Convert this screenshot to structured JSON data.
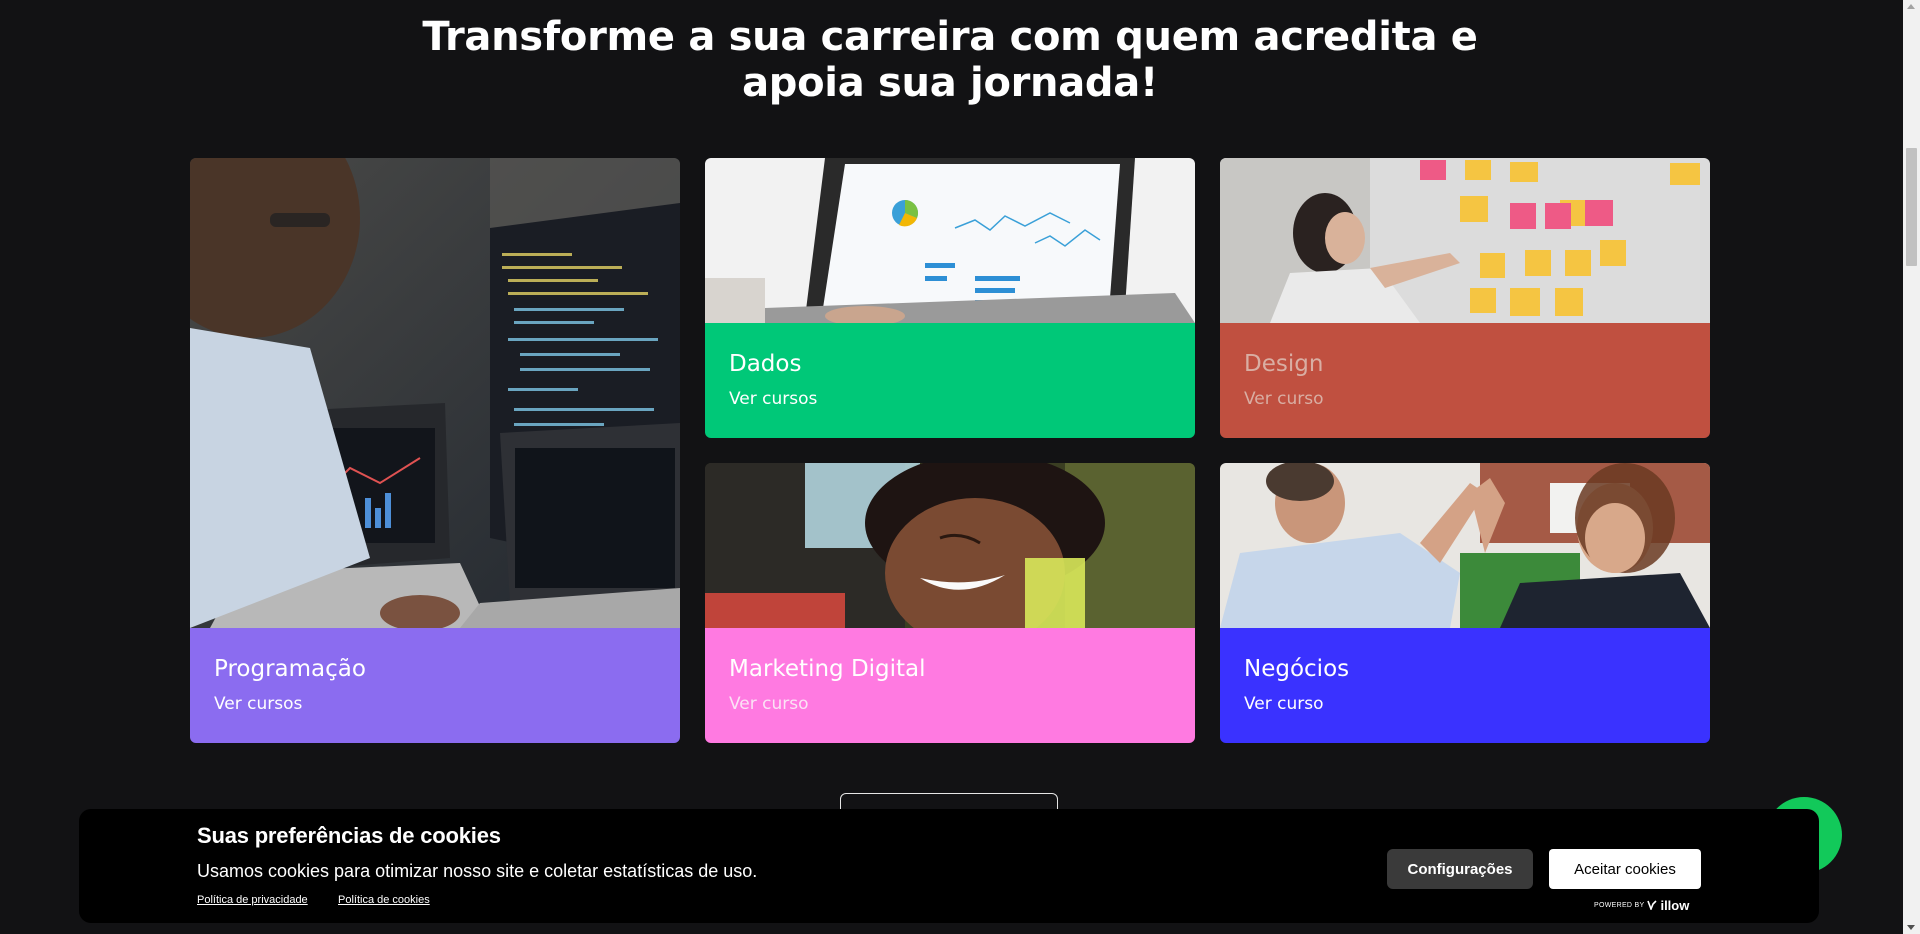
{
  "headline": {
    "line1": "Transforme a sua carreira com quem acredita e",
    "line2": "apoia sua jornada!"
  },
  "cards": [
    {
      "title": "Programação",
      "link": "Ver cursos",
      "color": "#8b6cf0",
      "image": "developer-laptops-code-photo"
    },
    {
      "title": "Dados",
      "link": "Ver cursos",
      "color": "#00c878",
      "image": "laptop-analytics-dashboard-photo"
    },
    {
      "title": "Design",
      "link": "Ver curso",
      "color": "#c05040",
      "image": "woman-sticky-notes-photo"
    },
    {
      "title": "Marketing Digital",
      "link": "Ver curso",
      "color": "#ff7ae1",
      "image": "smiling-woman-photo"
    },
    {
      "title": "Negócios",
      "link": "Ver curso",
      "color": "#3a32ff",
      "image": "business-high-five-photo"
    }
  ],
  "cookie_banner": {
    "title": "Suas preferências de cookies",
    "text": "Usamos cookies para otimizar nosso site e coletar estatísticas de uso.",
    "privacy_link": "Política de privacidade",
    "cookies_link": "Política de cookies",
    "settings_button": "Configurações",
    "accept_button": "Aceitar cookies",
    "powered_by": "POWERED BY",
    "brand": "illow"
  },
  "colors": {
    "background": "#121214",
    "whatsapp": "#12c95a"
  }
}
